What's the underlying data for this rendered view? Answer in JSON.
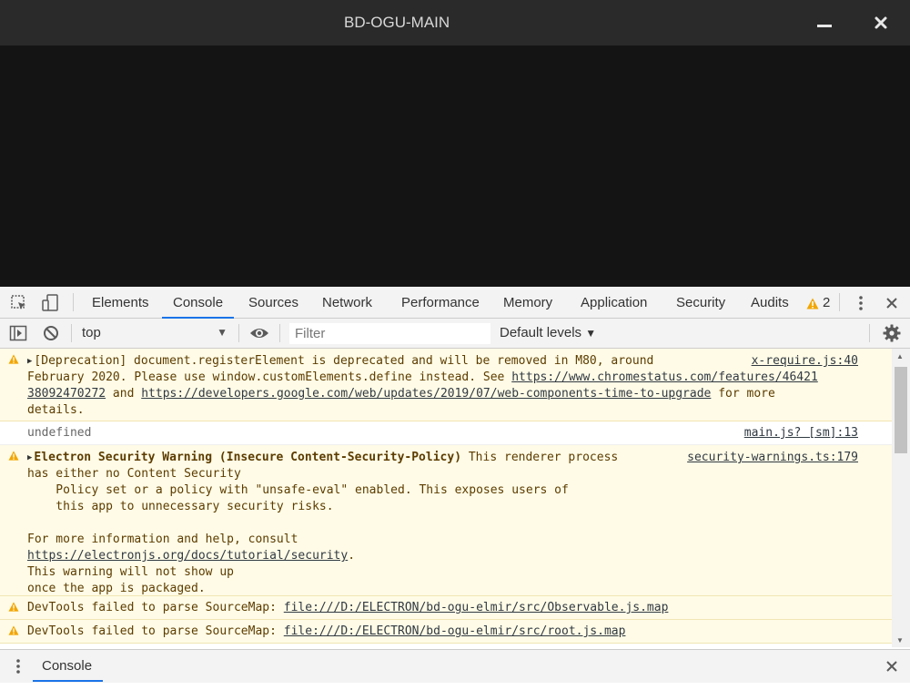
{
  "window": {
    "title": "BD-OGU-MAIN"
  },
  "devtools": {
    "tabs": [
      {
        "label": "Elements"
      },
      {
        "label": "Console"
      },
      {
        "label": "Sources"
      },
      {
        "label": "Network"
      },
      {
        "label": "Performance"
      },
      {
        "label": "Memory"
      },
      {
        "label": "Application"
      },
      {
        "label": "Security"
      },
      {
        "label": "Audits"
      }
    ],
    "active_tab": "Console",
    "warning_count": "2",
    "toolbar": {
      "context": "top",
      "filter_placeholder": "Filter",
      "levels_label": "Default levels"
    },
    "messages": {
      "m1": {
        "line1": "[Deprecation] document.registerElement is deprecated and will be removed in M80, around",
        "line2a": "February 2020. Please use window.customElements.define instead. See ",
        "link1a": "https://www.chromestatus.com/features/46421",
        "link1b": "38092470272",
        "and": " and ",
        "link2": "https://developers.google.com/web/updates/2019/07/web-components-time-to-upgrade",
        "tail": " for more",
        "line4": "details.",
        "source": "x-require.js:40"
      },
      "m2": {
        "text": "undefined",
        "source": "main.js? [sm]:13"
      },
      "m3": {
        "bold": "Electron Security Warning (Insecure Content-Security-Policy)",
        "rest": " This renderer process",
        "line2": "has either no Content Security",
        "line3": "    Policy set or a policy with \"unsafe-eval\" enabled. This exposes users of",
        "line4": "    this app to unnecessary security risks.",
        "line6": "For more information and help, consult",
        "link": "https://electronjs.org/docs/tutorial/security",
        "dot": ".",
        "line8": "This warning will not show up",
        "line9": "once the app is packaged.",
        "source": "security-warnings.ts:179"
      },
      "m4": {
        "prefix": "DevTools failed to parse SourceMap: ",
        "link": "file:///D:/ELECTRON/bd-ogu-elmir/src/Observable.js.map"
      },
      "m5": {
        "prefix": "DevTools failed to parse SourceMap: ",
        "link": "file:///D:/ELECTRON/bd-ogu-elmir/src/root.js.map"
      }
    },
    "drawer": {
      "tab_label": "Console"
    }
  },
  "colors": {
    "accent": "#1a73e8",
    "warning_icon": "#f2a600",
    "warning_bg": "#fffbe6"
  }
}
